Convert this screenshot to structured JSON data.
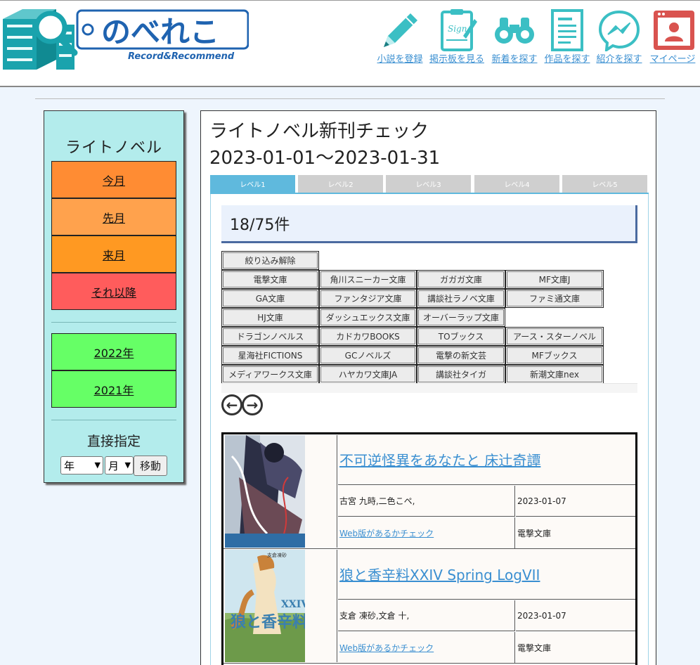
{
  "header": {
    "logo_text": "のべれこ",
    "logo_sub": "Record&Recommend",
    "nav": [
      {
        "label": "小説を登録",
        "icon": "pencil-icon"
      },
      {
        "label": "掲示板を見る",
        "icon": "clipboard-sign-icon"
      },
      {
        "label": "新着を探す",
        "icon": "binoculars-icon"
      },
      {
        "label": "作品を探す",
        "icon": "document-icon"
      },
      {
        "label": "紹介を探す",
        "icon": "messenger-icon"
      },
      {
        "label": "マイページ",
        "icon": "user-profile-icon"
      }
    ]
  },
  "sidebar": {
    "title": "ライトノベル",
    "month_buttons": [
      {
        "label": "今月",
        "color": "#ff8c33"
      },
      {
        "label": "先月",
        "color": "#ffa24d"
      },
      {
        "label": "来月",
        "color": "#ff9922"
      },
      {
        "label": "それ以降",
        "color": "#ff5c5c"
      }
    ],
    "year_buttons": [
      {
        "label": "2022年",
        "color": "#66ff66"
      },
      {
        "label": "2021年",
        "color": "#66ff66"
      }
    ],
    "direct_label": "直接指定",
    "year_select": "年",
    "month_select": "月",
    "move_button": "移動"
  },
  "main": {
    "title_line1": "ライトノベル新刊チェック",
    "title_line2": "2023-01-01～2023-01-31",
    "tabs": [
      "レベル1",
      "レベル2",
      "レベル3",
      "レベル4",
      "レベル5"
    ],
    "active_tab": 0,
    "count": "18/75件",
    "filter_clear": "絞り込み解除",
    "filters": [
      [
        "電撃文庫",
        "角川スニーカー文庫",
        "ガガガ文庫",
        "MF文庫J"
      ],
      [
        "GA文庫",
        "ファンタジア文庫",
        "講談社ラノベ文庫",
        "ファミ通文庫"
      ],
      [
        "HJ文庫",
        "ダッシュエックス文庫",
        "オーバーラップ文庫"
      ],
      [
        "ドラゴンノベルス",
        "カドカワBOOKS",
        "TOブックス",
        "アース・スターノベル"
      ],
      [
        "星海社FICTIONS",
        "GCノベルズ",
        "電撃の新文芸",
        "MFブックス"
      ],
      [
        "メディアワークス文庫",
        "ハヤカワ文庫JA",
        "講談社タイガ",
        "新潮文庫nex"
      ]
    ],
    "prev_icon": "arrow-left-circle-icon",
    "next_icon": "arrow-right-circle-icon",
    "books": [
      {
        "title": "不可逆怪異をあなたと 床辻奇譚",
        "author": "古宮 九時,二色こペ,",
        "date": "2023-01-07",
        "web_check": "Web版があるかチェック",
        "label": "電撃文庫"
      },
      {
        "title": "狼と香辛料XXIV Spring LogVII",
        "author": "支倉 凍砂,文倉 十,",
        "date": "2023-01-07",
        "web_check": "Web版があるかチェック",
        "label": "電撃文庫"
      }
    ]
  }
}
